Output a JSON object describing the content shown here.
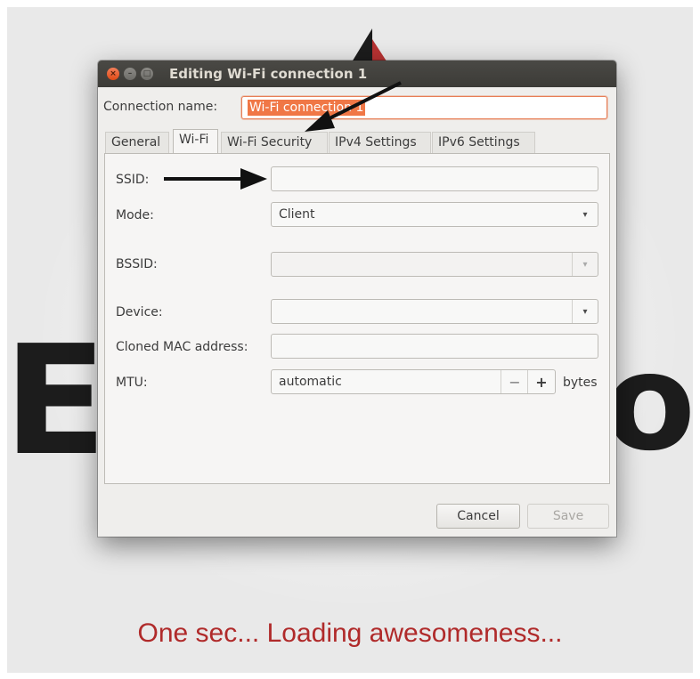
{
  "dialog": {
    "title": "Editing Wi-Fi connection 1",
    "window_buttons": {
      "close": "×",
      "minimize": "–",
      "maximize": "□"
    },
    "connection_name_label": "Connection name:",
    "connection_name_value": "Wi-Fi connection 1"
  },
  "tabs": [
    {
      "label": "General",
      "active": false
    },
    {
      "label": "Wi-Fi",
      "active": true
    },
    {
      "label": "Wi-Fi Security",
      "active": false
    },
    {
      "label": "IPv4 Settings",
      "active": false
    },
    {
      "label": "IPv6 Settings",
      "active": false
    }
  ],
  "wifi": {
    "ssid_label": "SSID:",
    "ssid_value": "",
    "mode_label": "Mode:",
    "mode_value": "Client",
    "bssid_label": "BSSID:",
    "bssid_value": "",
    "device_label": "Device:",
    "device_value": "",
    "cloned_mac_label": "Cloned MAC address:",
    "cloned_mac_value": "",
    "mtu_label": "MTU:",
    "mtu_value": "automatic",
    "mtu_minus": "−",
    "mtu_plus": "+",
    "mtu_unit": "bytes"
  },
  "buttons": {
    "cancel": "Cancel",
    "save": "Save"
  },
  "background": {
    "letter_left": "E",
    "letter_right": "o",
    "loading_text": "One sec... Loading awesomeness..."
  },
  "icons": {
    "dropdown": "▾",
    "logo": "logo-icon",
    "annotation": "arrow-icon"
  },
  "colors": {
    "accent": "#f07746",
    "loading_text": "#b02a2a",
    "titlebar": "#3c3b37"
  }
}
